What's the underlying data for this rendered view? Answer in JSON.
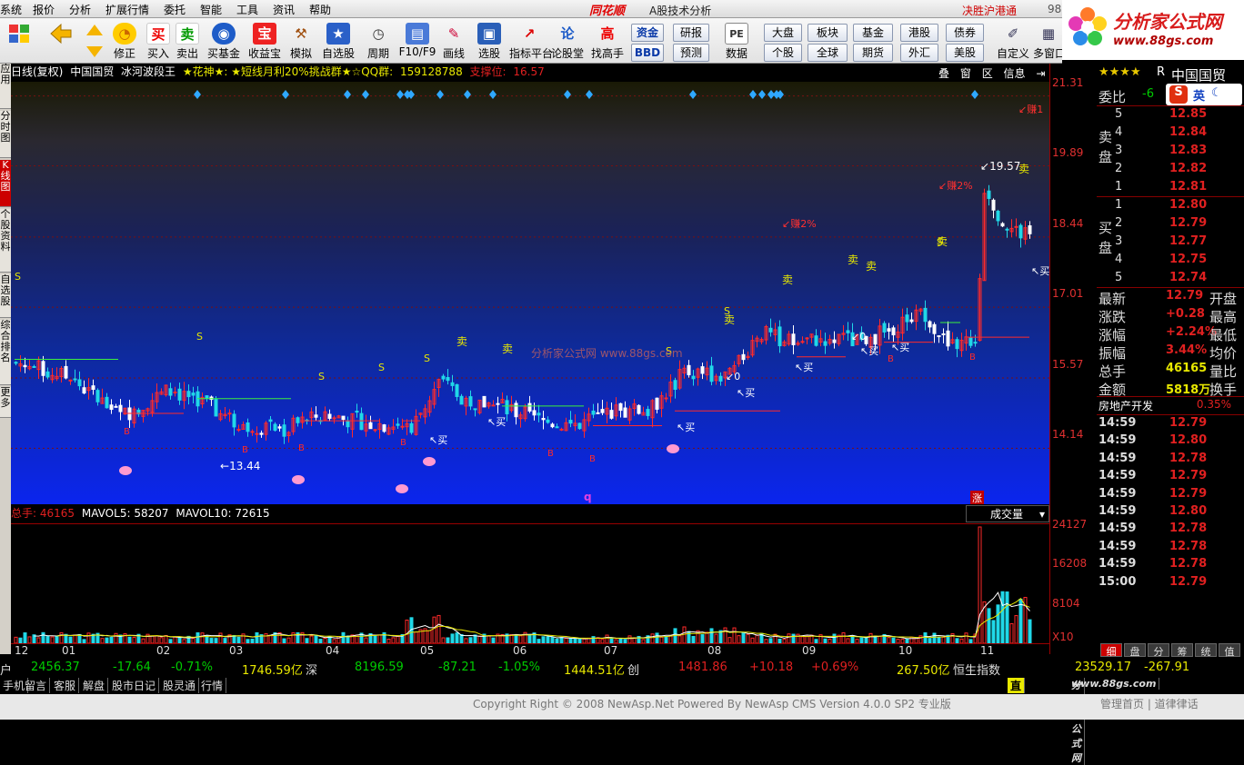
{
  "menu": {
    "items": [
      "系统",
      "报价",
      "分析",
      "扩展行情",
      "委托",
      "智能",
      "工具",
      "资讯",
      "帮助"
    ],
    "brand": "同花顺",
    "app_title": "A股技术分析",
    "banner": "决胜沪港通",
    "top_number": "98"
  },
  "logo": {
    "brand": "分析家公式网",
    "url": "www.88gs.com"
  },
  "toolbar": {
    "buttons": [
      {
        "label": "",
        "icon": "grid-icon"
      },
      {
        "label": "",
        "icon": "back-arrow-icon"
      },
      {
        "label": "",
        "icon": "updown-arrow-icon"
      },
      {
        "label": "修正",
        "icon": "circle-icon"
      },
      {
        "label": "买入",
        "icon": "buy-icon",
        "glyph": "买"
      },
      {
        "label": "卖出",
        "icon": "sell-icon",
        "glyph": "卖"
      },
      {
        "label": "买基金",
        "icon": "fund-icon"
      },
      {
        "label": "收益宝",
        "icon": "treasure-icon",
        "glyph": "宝"
      },
      {
        "label": "模拟",
        "icon": "hammer-icon"
      },
      {
        "label": "自选股",
        "icon": "star-icon"
      },
      {
        "label": "周期",
        "icon": "clock-icon"
      },
      {
        "label": "F10/F9",
        "icon": "f10-icon"
      },
      {
        "label": "画线",
        "icon": "pen-icon"
      },
      {
        "label": "选股",
        "icon": "screen-icon"
      },
      {
        "label": "指标平台",
        "icon": "indicator-icon"
      },
      {
        "label": "论股堂",
        "icon": "talk-icon",
        "glyph": "论"
      },
      {
        "label": "找高手",
        "icon": "expert-icon",
        "glyph": "高"
      },
      {
        "label": "数据",
        "icon": "pe-icon",
        "glyph": "PE"
      },
      {
        "label": "自定义",
        "icon": "custom-icon"
      },
      {
        "label": "多窗口",
        "icon": "multiwindow-icon"
      }
    ],
    "small_buttons": [
      "资金",
      "BBD",
      "研报",
      "预测",
      "大盘",
      "个股",
      "板块",
      "全球",
      "基金",
      "期货",
      "港股",
      "外汇",
      "债券",
      "美股"
    ]
  },
  "left_tabs": [
    "应用",
    "分时图",
    "K线图",
    "个股资料",
    "自选股",
    "综合排名",
    "更多"
  ],
  "chart": {
    "header": {
      "period": "日线(复权)",
      "stock_name": "中国国贸",
      "indicator": "冰河波段王",
      "slogan": "★花神★: ★短线月利20%挑战群★☆QQ群:",
      "qq": "159128788",
      "support_label": "支撑位:",
      "support_value": "16.57"
    },
    "controls": [
      "叠",
      "窗",
      "区",
      "信息"
    ],
    "y_labels": [
      "21.31",
      "19.89",
      "18.44",
      "17.01",
      "15.57",
      "14.14"
    ],
    "annotations": {
      "high": "19.57",
      "low": "13.44",
      "watermark": "分析家公式网",
      "watermark_url": "www.88gs.com",
      "earn_labels": [
        "赚2%",
        "赚2%",
        "赚1"
      ],
      "buy_label": "买",
      "sell_label": "卖",
      "s_label": "S",
      "b_label": "B",
      "zero_label": "0",
      "q_label": "q",
      "rise_label": "涨"
    }
  },
  "volume": {
    "label_total": "总手:",
    "total": "46165",
    "mavol5_label": "MAVOL5:",
    "mavol5": "58207",
    "mavol10_label": "MAVOL10:",
    "mavol10": "72615",
    "dropdown": "成交量",
    "y_labels": [
      "24127",
      "16208",
      "8104"
    ],
    "unit": "X10"
  },
  "x_axis": [
    "12",
    "01",
    "02",
    "03",
    "04",
    "05",
    "06",
    "07",
    "08",
    "09",
    "10",
    "11"
  ],
  "right_panel": {
    "stock_name": "中国国贸",
    "stars": "★★★★",
    "r_mark": "R",
    "weibi_label": "委比",
    "weibi_value": "-6",
    "ime_label": "英",
    "sell_label": [
      "卖",
      "盘"
    ],
    "buy_label": [
      "买",
      "盘"
    ],
    "sell_orders": [
      {
        "level": "5",
        "price": "12.85"
      },
      {
        "level": "4",
        "price": "12.84"
      },
      {
        "level": "3",
        "price": "12.83"
      },
      {
        "level": "2",
        "price": "12.82"
      },
      {
        "level": "1",
        "price": "12.81"
      }
    ],
    "buy_orders": [
      {
        "level": "1",
        "price": "12.80"
      },
      {
        "level": "2",
        "price": "12.79"
      },
      {
        "level": "3",
        "price": "12.77"
      },
      {
        "level": "4",
        "price": "12.75"
      },
      {
        "level": "5",
        "price": "12.74"
      }
    ],
    "stats": [
      {
        "label": "最新",
        "value": "12.79",
        "label2": "开盘"
      },
      {
        "label": "涨跌",
        "value": "+0.28",
        "label2": "最高"
      },
      {
        "label": "涨幅",
        "value": "+2.24%",
        "label2": "最低"
      },
      {
        "label": "振幅",
        "value": "3.44%",
        "label2": "均价"
      },
      {
        "label": "总手",
        "value": "46165",
        "label2": "量比"
      },
      {
        "label": "金额",
        "value": "5818万",
        "label2": "换手"
      }
    ],
    "sector": {
      "name": "房地产开发",
      "change": "0.35%"
    },
    "ticks": [
      {
        "time": "14:59",
        "price": "12.79"
      },
      {
        "time": "14:59",
        "price": "12.80"
      },
      {
        "time": "14:59",
        "price": "12.78"
      },
      {
        "time": "14:59",
        "price": "12.79"
      },
      {
        "time": "14:59",
        "price": "12.79"
      },
      {
        "time": "14:59",
        "price": "12.80"
      },
      {
        "time": "14:59",
        "price": "12.78"
      },
      {
        "time": "14:59",
        "price": "12.78"
      },
      {
        "time": "14:59",
        "price": "12.78"
      },
      {
        "time": "15:00",
        "price": "12.79"
      }
    ],
    "bottom_tabs": [
      "细",
      "盘",
      "分",
      "筹",
      "统",
      "值"
    ]
  },
  "status": {
    "sh_label": "户",
    "sh_index": "2456.37",
    "sh_change": "-17.64",
    "sh_pct": "-0.71%",
    "sh_amount": "1746.59亿",
    "sz_label": "深",
    "sz_index": "8196.59",
    "sz_change": "-87.21",
    "sz_pct": "-1.05%",
    "sz_amount": "1444.51亿",
    "cy_label": "创",
    "cy_index": "1481.86",
    "cy_change": "+10.18",
    "cy_pct": "+0.69%",
    "cy_amount": "267.50亿",
    "hs_label": "恒生指数",
    "hs_index": "23529.17",
    "hs_change": "-267.91"
  },
  "tabbar": [
    "手机",
    "留言",
    "客服",
    "解盘",
    "股市日记",
    "股灵通",
    "行情"
  ],
  "tabbar_mark": "直",
  "footer": {
    "copyright": "Copyright Right © 2008 NewAsp.Net Powered By NewAsp CMS Version 4.0.0 SP2 专业版",
    "links": "管理首页 | 道律律话"
  },
  "colors": {
    "up": "#e02020",
    "down": "#00d0d0",
    "accent": "#e8e800",
    "line": "#3cf03c"
  }
}
